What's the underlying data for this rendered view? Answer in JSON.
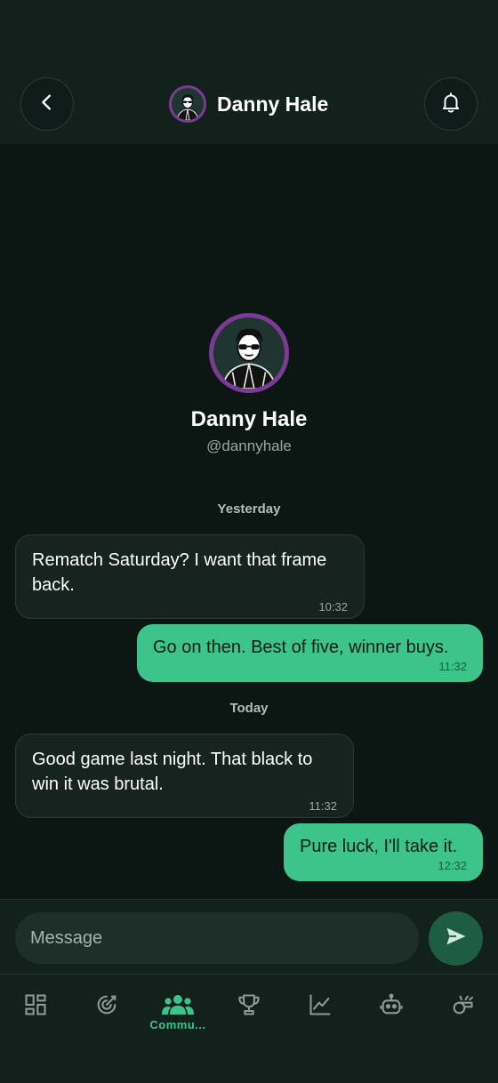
{
  "header": {
    "title": "Danny Hale",
    "back_icon": "chevron-left-icon",
    "bell_icon": "bell-icon"
  },
  "profile": {
    "name": "Danny Hale",
    "handle": "@dannyhale"
  },
  "conversation": [
    {
      "day": "Yesterday",
      "messages": [
        {
          "direction": "incoming",
          "text": "Rematch Saturday? I want that frame back.",
          "time": "10:32"
        },
        {
          "direction": "outgoing",
          "text": "Go on then. Best of five, winner buys.",
          "time": "11:32"
        }
      ]
    },
    {
      "day": "Today",
      "messages": [
        {
          "direction": "incoming",
          "text": "Good game last night. That black to win it was brutal.",
          "time": "11:32"
        },
        {
          "direction": "outgoing",
          "text": "Pure luck, I'll take it.",
          "time": "12:32"
        }
      ]
    }
  ],
  "composer": {
    "placeholder": "Message",
    "send_icon": "send-icon"
  },
  "nav": {
    "active_label": "Commu...",
    "items": [
      {
        "icon": "dashboard-icon"
      },
      {
        "icon": "target-icon"
      },
      {
        "icon": "community-icon",
        "label": "Commu...",
        "active": true
      },
      {
        "icon": "trophy-icon"
      },
      {
        "icon": "chart-icon"
      },
      {
        "icon": "robot-icon"
      },
      {
        "icon": "whistle-icon"
      }
    ]
  },
  "colors": {
    "background": "#0c1714",
    "header": "#13211d",
    "accent": "#3cc48a",
    "avatar_ring": "#7b3a93",
    "incoming_bubble": "#16231f",
    "nav_icon": "#8e9995"
  }
}
